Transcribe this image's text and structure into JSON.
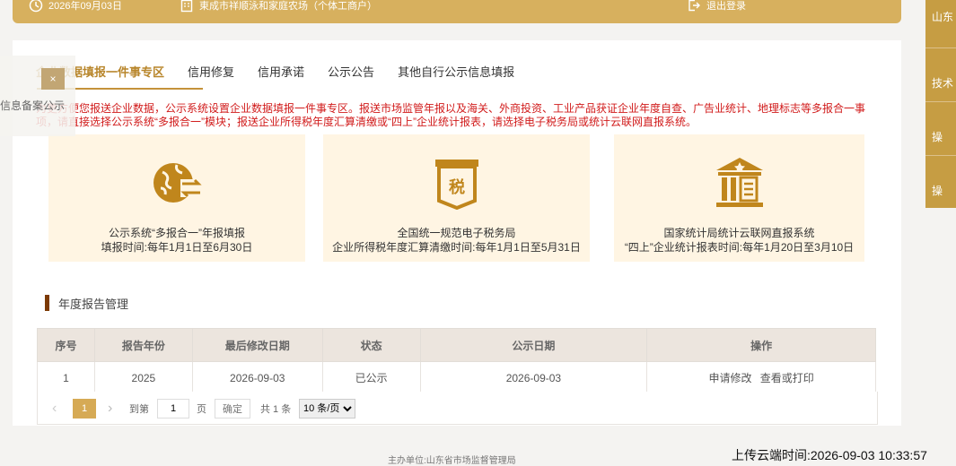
{
  "topbar": {
    "date": "2026年09月03日",
    "business_name": "東成市祥顺泳和家庭农场（个体工商户）",
    "logout": "退出登录"
  },
  "right_rail": [
    "山东",
    "技术",
    "操",
    "操"
  ],
  "tabs": [
    {
      "label": "企业数据填报一件事专区",
      "active": true
    },
    {
      "label": "信用修复",
      "active": false
    },
    {
      "label": "信用承诺",
      "active": false
    },
    {
      "label": "公示公告",
      "active": false
    },
    {
      "label": "其他自行公示信息填报",
      "active": false
    }
  ],
  "notice": "为更方便您报送企业数据，公示系统设置企业数据填报一件事专区。报送市场监管年报以及海关、外商投资、工业产品获证企业年度自查、广告业统计、地理标志等多报合一事项，请直接选择公示系统“多报合一”模块；报送企业所得税年度汇算清缴或“四上”企业统计报表，请选择电子税务局或统计云联网直报系统。",
  "features": [
    {
      "title": "公示系统“多报合一”年报填报",
      "time": "填报时间:每年1月1日至6月30日",
      "icon": "globe-exchange-icon"
    },
    {
      "title": "全国统一规范电子税务局",
      "time": "企业所得税年度汇算清缴时间:每年1月1日至5月31日",
      "icon": "tax-banner-icon"
    },
    {
      "title": "国家统计局统计云联网直报系统",
      "time": "“四上”企业统计报表时间:每年1月20日至3月10日",
      "icon": "government-building-icon"
    }
  ],
  "section_title": "年度报告管理",
  "table": {
    "headers": [
      "序号",
      "报告年份",
      "最后修改日期",
      "状态",
      "公示日期",
      "操作"
    ],
    "rows": [
      {
        "index": "1",
        "year": "2025",
        "modified": "2026-09-03",
        "status": "已公示",
        "published": "2026-09-03",
        "actions": [
          "申请修改",
          "查看或打印"
        ]
      }
    ]
  },
  "pager": {
    "current": "1",
    "goto_label": "到第",
    "goto_value": "1",
    "page_unit": "页",
    "confirm": "确定",
    "total": "共 1 条",
    "page_size": "10 条/页"
  },
  "floating": {
    "close": "×",
    "text": "信息备案公示"
  },
  "footer": {
    "org": "主办单位:山东省市场监督管理局",
    "upload_time": "上传云端时间:2026-09-03 10:33:57"
  },
  "colors": {
    "gold": "#d7b05e",
    "notice_red": "#d11b1b",
    "feature_bg": "#fff5e3"
  }
}
